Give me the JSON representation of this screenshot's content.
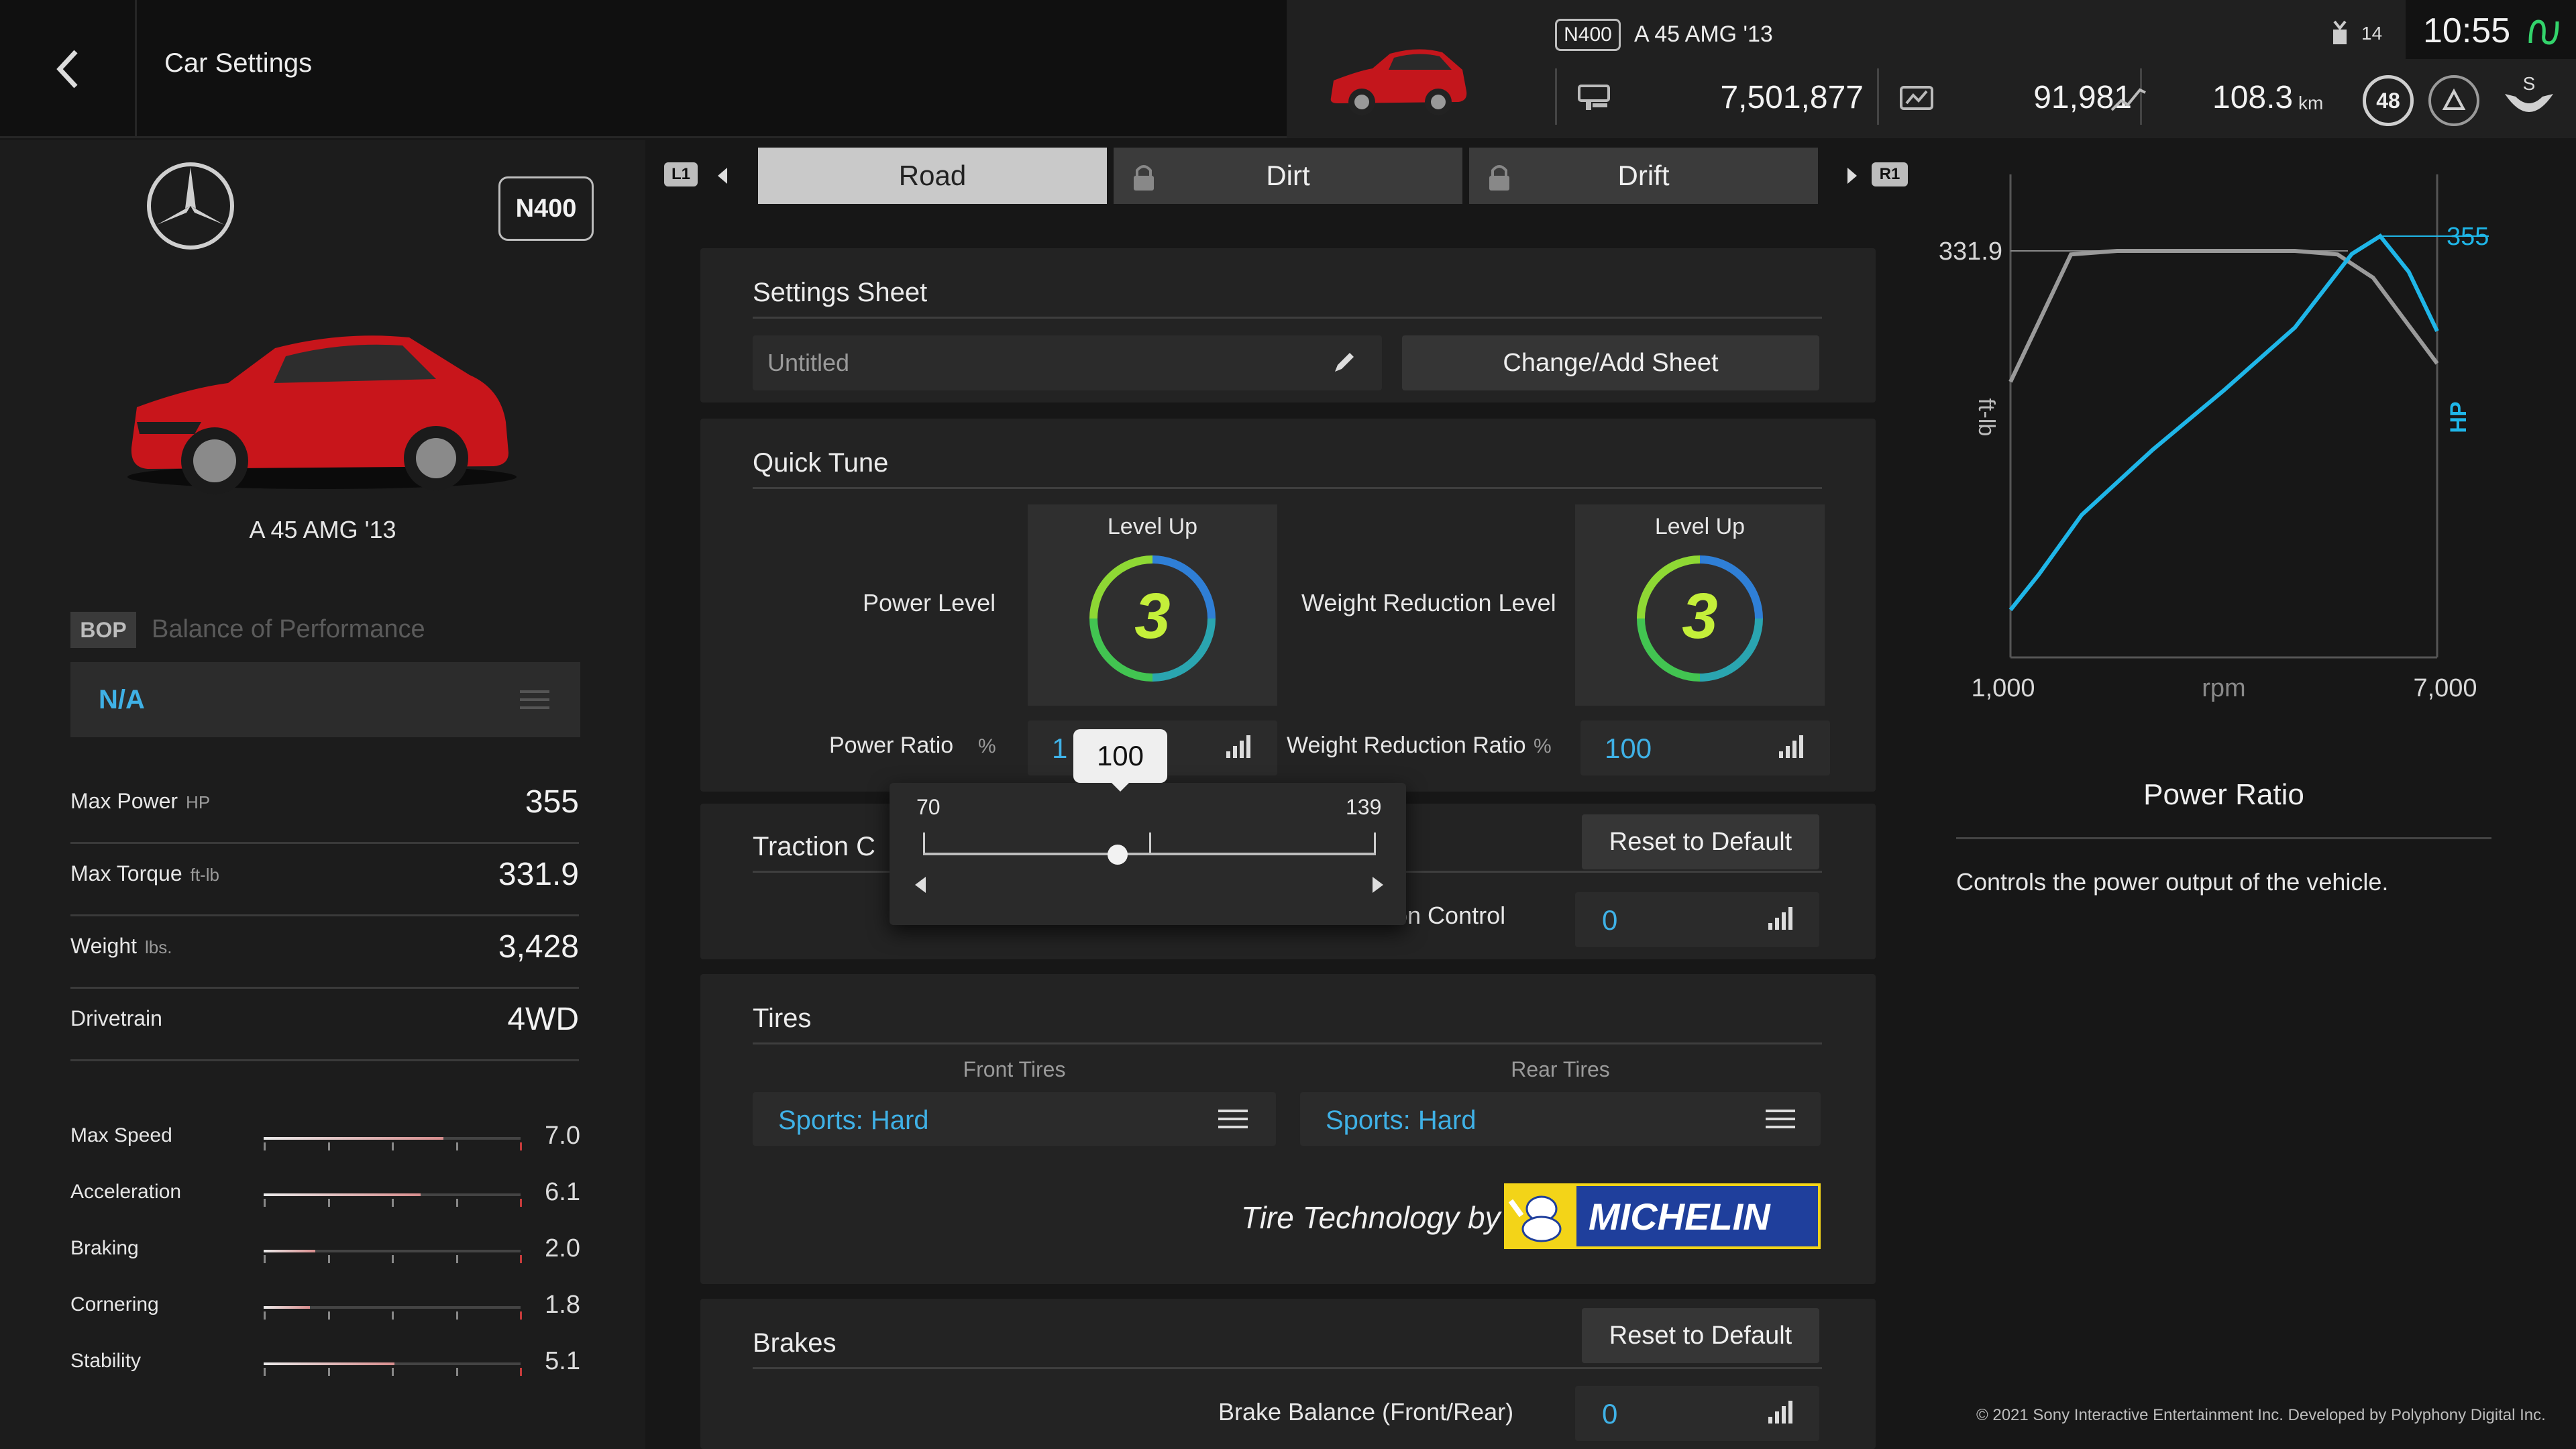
{
  "header": {
    "title": "Car Settings",
    "car_badge": "N400",
    "car_name": "A 45 AMG '13",
    "credits": "7,501,877",
    "mileage_points": "91,981",
    "distance": "108.3",
    "distance_unit": "km",
    "level_badge": "48",
    "gift_count": "14",
    "clock": "10:55"
  },
  "left": {
    "pp_badge": "N400",
    "car_name": "A 45 AMG '13",
    "bop_tag": "BOP",
    "bop_label": "Balance of Performance",
    "bop_value": "N/A",
    "stats": [
      {
        "label": "Max Power",
        "unit": "HP",
        "value": "355"
      },
      {
        "label": "Max Torque",
        "unit": "ft-lb",
        "value": "331.9"
      },
      {
        "label": "Weight",
        "unit": "lbs.",
        "value": "3,428"
      },
      {
        "label": "Drivetrain",
        "unit": "",
        "value": "4WD"
      }
    ],
    "performance": [
      {
        "label": "Max Speed",
        "value": "7.0",
        "fraction": 0.7
      },
      {
        "label": "Acceleration",
        "value": "6.1",
        "fraction": 0.61
      },
      {
        "label": "Braking",
        "value": "2.0",
        "fraction": 0.2
      },
      {
        "label": "Cornering",
        "value": "1.8",
        "fraction": 0.18
      },
      {
        "label": "Stability",
        "value": "5.1",
        "fraction": 0.51
      }
    ]
  },
  "tabs": {
    "left_hint": "L1",
    "right_hint": "R1",
    "items": [
      {
        "label": "Road",
        "active": true,
        "locked": false
      },
      {
        "label": "Dirt",
        "active": false,
        "locked": true
      },
      {
        "label": "Drift",
        "active": false,
        "locked": true
      }
    ]
  },
  "settings_sheet": {
    "title": "Settings Sheet",
    "sheet_name": "Untitled",
    "change_button": "Change/Add Sheet"
  },
  "quick_tune": {
    "title": "Quick Tune",
    "power_level_label": "Power Level",
    "power_level_header": "Level Up",
    "power_level_value": "3",
    "weight_level_label": "Weight Reduction Level",
    "weight_level_header": "Level Up",
    "weight_level_value": "3",
    "power_ratio_label": "Power Ratio",
    "power_ratio_unit": "%",
    "power_ratio_value_visible": "1",
    "weight_ratio_label": "Weight Reduction Ratio",
    "weight_ratio_unit": "%",
    "weight_ratio_value": "100"
  },
  "slider_popup": {
    "current": "100",
    "min": "70",
    "max": "139",
    "fraction": 0.43
  },
  "traction": {
    "title_partial": "Traction C",
    "reset_button": "Reset to Default",
    "control_label_partial": "raction Control",
    "control_value": "0"
  },
  "tires": {
    "title": "Tires",
    "front_label": "Front Tires",
    "front_value": "Sports: Hard",
    "rear_label": "Rear Tires",
    "rear_value": "Sports: Hard",
    "tech_label": "Tire Technology by",
    "brand": "MICHELIN"
  },
  "brakes": {
    "title": "Brakes",
    "reset_button": "Reset to Default",
    "balance_label": "Brake Balance (Front/Rear)",
    "balance_value": "0"
  },
  "chart_data": {
    "type": "line",
    "xlabel": "rpm",
    "ylabel_left": "ft-lb",
    "ylabel_right": "HP",
    "x_min_label": "1,000",
    "x_max_label": "7,000",
    "torque_peak_label": "331.9",
    "power_peak_label": "355",
    "series": [
      {
        "name": "ft-lb",
        "color": "#9a9a9a",
        "x": [
          1000,
          1850,
          2500,
          3000,
          4000,
          5000,
          5600,
          6100,
          7000
        ],
        "y": [
          225,
          329,
          331.9,
          331.9,
          331.9,
          331.9,
          329,
          310,
          240
        ]
      },
      {
        "name": "HP",
        "color": "#1fb6e8",
        "x": [
          1000,
          1400,
          2000,
          3000,
          4000,
          5000,
          5800,
          6200,
          6600,
          7000
        ],
        "y": [
          40,
          70,
          120,
          175,
          225,
          278,
          340,
          355,
          325,
          275
        ]
      }
    ]
  },
  "info": {
    "title": "Power Ratio",
    "description": "Controls the power output of the vehicle."
  },
  "footer": {
    "copyright": "© 2021 Sony Interactive Entertainment Inc. Developed by Polyphony Digital Inc."
  }
}
